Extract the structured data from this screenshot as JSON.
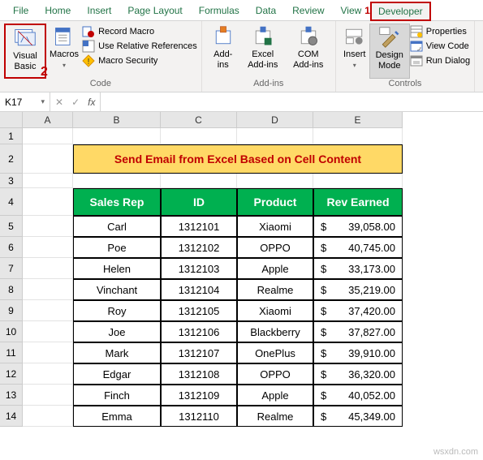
{
  "tabs": {
    "file": "File",
    "home": "Home",
    "insert": "Insert",
    "page_layout": "Page Layout",
    "formulas": "Formulas",
    "data": "Data",
    "review": "Review",
    "view": "View",
    "developer": "Developer"
  },
  "annotations": {
    "one": "1",
    "two": "2"
  },
  "ribbon": {
    "code": {
      "visual_basic": "Visual Basic",
      "macros": "Macros",
      "record_macro": "Record Macro",
      "use_relative": "Use Relative References",
      "macro_security": "Macro Security",
      "group_label": "Code"
    },
    "addins": {
      "addins": "Add-ins",
      "excel_addins": "Excel Add-ins",
      "com_addins": "COM Add-ins",
      "group_label": "Add-ins"
    },
    "controls": {
      "insert": "Insert",
      "design_mode": "Design Mode",
      "properties": "Properties",
      "view_code": "View Code",
      "run_dialog": "Run Dialog",
      "group_label": "Controls"
    }
  },
  "namebox": "K17",
  "columns": [
    "A",
    "B",
    "C",
    "D",
    "E"
  ],
  "rows": [
    "1",
    "2",
    "3",
    "4",
    "5",
    "6",
    "7",
    "8",
    "9",
    "10",
    "11",
    "12",
    "13",
    "14"
  ],
  "title": "Send Email from Excel Based on Cell Content",
  "headers": {
    "b": "Sales Rep",
    "c": "ID",
    "d": "Product",
    "e": "Rev Earned"
  },
  "table": [
    {
      "rep": "Carl",
      "id": "1312101",
      "product": "Xiaomi",
      "rev": "39,058.00"
    },
    {
      "rep": "Poe",
      "id": "1312102",
      "product": "OPPO",
      "rev": "40,745.00"
    },
    {
      "rep": "Helen",
      "id": "1312103",
      "product": "Apple",
      "rev": "33,173.00"
    },
    {
      "rep": "Vinchant",
      "id": "1312104",
      "product": "Realme",
      "rev": "35,219.00"
    },
    {
      "rep": "Roy",
      "id": "1312105",
      "product": "Xiaomi",
      "rev": "37,420.00"
    },
    {
      "rep": "Joe",
      "id": "1312106",
      "product": "Blackberry",
      "rev": "37,827.00"
    },
    {
      "rep": "Mark",
      "id": "1312107",
      "product": "OnePlus",
      "rev": "39,910.00"
    },
    {
      "rep": "Edgar",
      "id": "1312108",
      "product": "OPPO",
      "rev": "36,320.00"
    },
    {
      "rep": "Finch",
      "id": "1312109",
      "product": "Apple",
      "rev": "40,052.00"
    },
    {
      "rep": "Emma",
      "id": "1312110",
      "product": "Realme",
      "rev": "45,349.00"
    }
  ],
  "currency": "$",
  "watermark": "wsxdn.com"
}
